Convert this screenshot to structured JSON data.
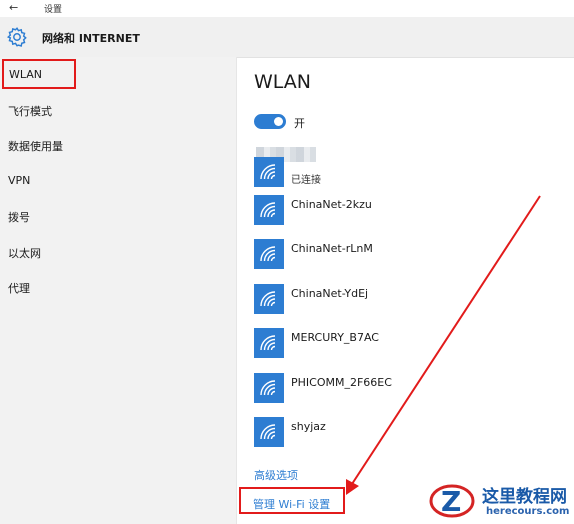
{
  "titlebar": {
    "back_glyph": "←",
    "title": "设置"
  },
  "header": {
    "icon": "gear-icon",
    "title": "网络和 INTERNET"
  },
  "sidebar": {
    "items": [
      {
        "label": "WLAN",
        "active": true
      },
      {
        "label": "飞行模式"
      },
      {
        "label": "数据使用量"
      },
      {
        "label": "VPN"
      },
      {
        "label": "拨号"
      },
      {
        "label": "以太网"
      },
      {
        "label": "代理"
      }
    ]
  },
  "main": {
    "title": "WLAN",
    "toggle": {
      "state": "on",
      "label": "开"
    },
    "networks": [
      {
        "name": "",
        "status": "已连接",
        "icon": "wifi-icon"
      },
      {
        "name": "ChinaNet-2kzu",
        "icon": "wifi-icon"
      },
      {
        "name": "ChinaNet-rLnM",
        "icon": "wifi-icon"
      },
      {
        "name": "ChinaNet-YdEj",
        "icon": "wifi-icon"
      },
      {
        "name": "MERCURY_B7AC",
        "icon": "wifi-icon"
      },
      {
        "name": "PHICOMM_2F66EC",
        "icon": "wifi-icon"
      },
      {
        "name": "shyjaz",
        "icon": "wifi-icon"
      }
    ],
    "advanced_link": "高级选项",
    "manage_link": "管理 Wi-Fi 设置"
  },
  "watermark": {
    "brand": "这里教程网",
    "url": "herecours.com"
  },
  "colors": {
    "accent": "#2d7dd2",
    "annotation": "#e21b1b",
    "sidebar_bg": "#f2f2f2",
    "header_bg": "#f0f0f0"
  }
}
